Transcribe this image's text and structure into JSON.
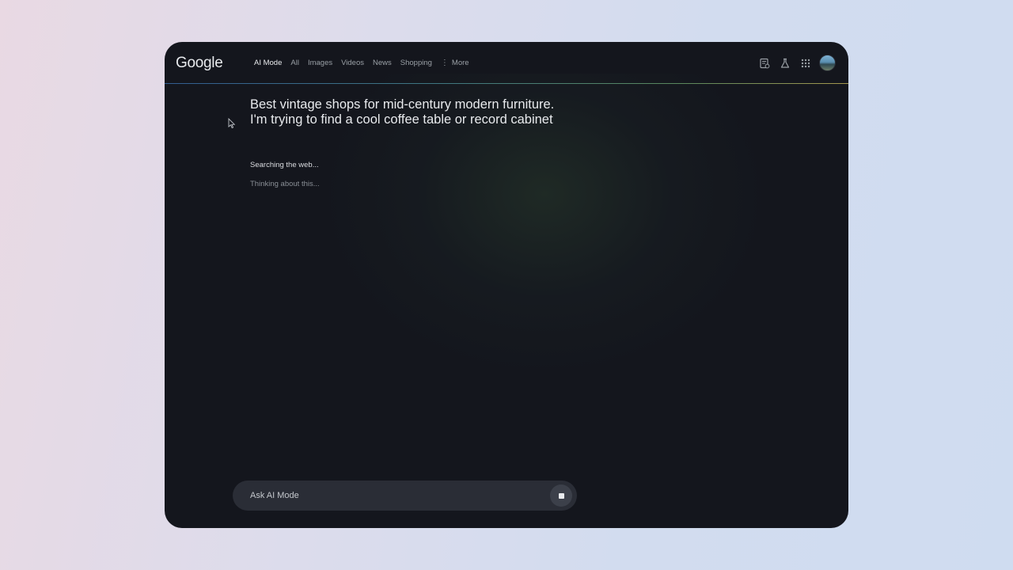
{
  "header": {
    "logo_text": "Google",
    "tabs": [
      {
        "label": "AI Mode",
        "active": true
      },
      {
        "label": "All"
      },
      {
        "label": "Images"
      },
      {
        "label": "Videos"
      },
      {
        "label": "News"
      },
      {
        "label": "Shopping"
      }
    ],
    "more_label": "More",
    "icons": [
      "history-icon",
      "labs-flask-icon",
      "apps-grid-icon",
      "account-avatar"
    ]
  },
  "main": {
    "query": "Best vintage shops for mid-century modern furniture. I'm trying to find a cool coffee table or record cabinet",
    "status_searching": "Searching the web...",
    "status_thinking": "Thinking about this..."
  },
  "askbar": {
    "placeholder": "Ask AI Mode",
    "value": "",
    "stop_icon": "stop-icon"
  },
  "colors": {
    "background": "#14161d",
    "text_primary": "#e8eaed",
    "text_muted": "#9aa0a6"
  }
}
